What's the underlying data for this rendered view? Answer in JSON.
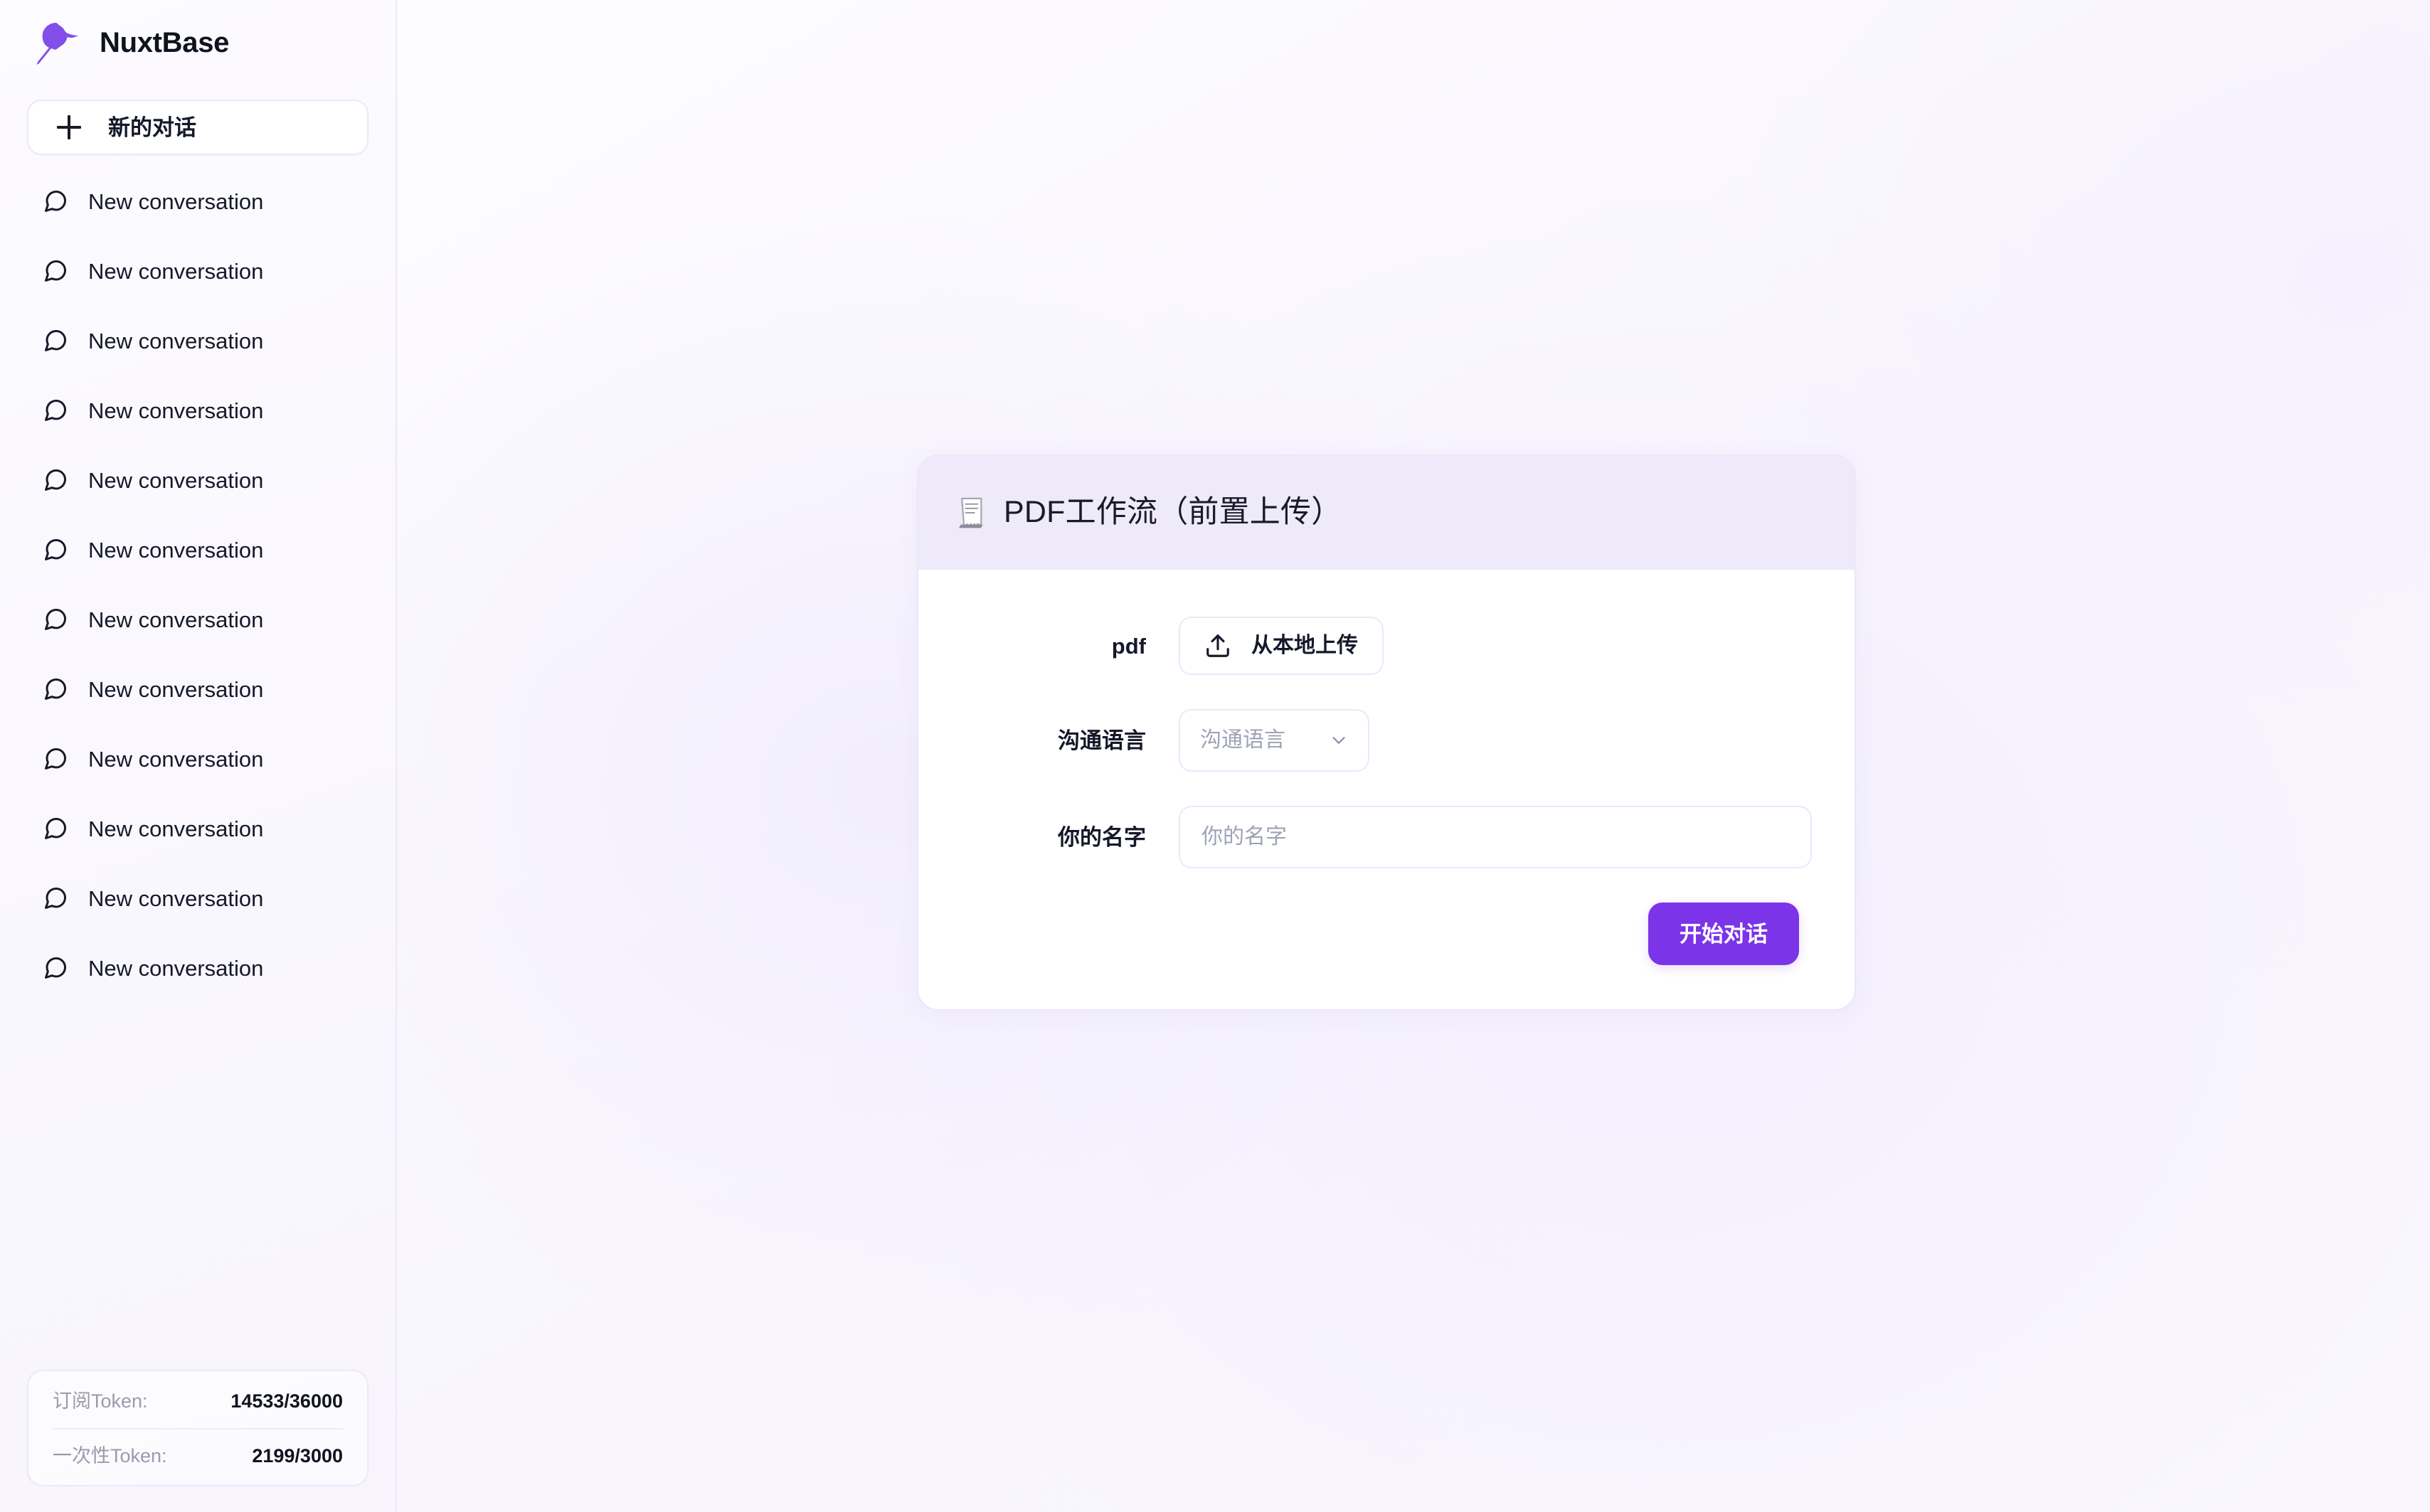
{
  "app": {
    "brand_name": "NuxtBase",
    "accent_color": "#7b34e8",
    "header_bg_color": "#efeafa",
    "border_color": "#ece7fa"
  },
  "sidebar": {
    "logo_icon": "hummingbird-logo-icon",
    "new_chat": {
      "label": "新的对话",
      "icon": "plus-icon"
    },
    "conversations": [
      {
        "label": "New conversation",
        "icon": "chat-bubble-icon"
      },
      {
        "label": "New conversation",
        "icon": "chat-bubble-icon"
      },
      {
        "label": "New conversation",
        "icon": "chat-bubble-icon"
      },
      {
        "label": "New conversation",
        "icon": "chat-bubble-icon"
      },
      {
        "label": "New conversation",
        "icon": "chat-bubble-icon"
      },
      {
        "label": "New conversation",
        "icon": "chat-bubble-icon"
      },
      {
        "label": "New conversation",
        "icon": "chat-bubble-icon"
      },
      {
        "label": "New conversation",
        "icon": "chat-bubble-icon"
      },
      {
        "label": "New conversation",
        "icon": "chat-bubble-icon"
      },
      {
        "label": "New conversation",
        "icon": "chat-bubble-icon"
      },
      {
        "label": "New conversation",
        "icon": "chat-bubble-icon"
      },
      {
        "label": "New conversation",
        "icon": "chat-bubble-icon"
      }
    ],
    "tokens": [
      {
        "key": "订阅Token:",
        "value": "14533/36000"
      },
      {
        "key": "一次性Token:",
        "value": "2199/3000"
      }
    ]
  },
  "main": {
    "card": {
      "header": {
        "icon": "document-icon",
        "title": "PDF工作流（前置上传）"
      },
      "fields": [
        {
          "label": "pdf",
          "control": "upload-button",
          "button_label": "从本地上传",
          "icon": "upload-icon"
        },
        {
          "label": "沟通语言",
          "control": "select",
          "placeholder": "沟通语言",
          "value": "",
          "icon": "chevron-down-icon"
        },
        {
          "label": "你的名字",
          "control": "text-input",
          "placeholder": "你的名字",
          "value": ""
        }
      ],
      "submit_label": "开始对话"
    }
  }
}
